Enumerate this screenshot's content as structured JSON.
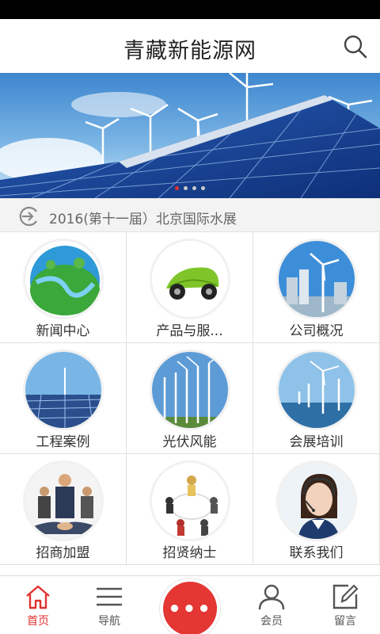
{
  "app": {
    "title": "青藏新能源网"
  },
  "colors": {
    "accent": "#e0312f",
    "header_bg": "#ffffff",
    "ticker_bg": "#f3f3f3"
  },
  "header": {
    "search_icon": "search-icon"
  },
  "banner": {
    "slides": 4,
    "active_slide": 1
  },
  "ticker": {
    "text": "2016(第十一届）北京国际水展",
    "icon": "refresh-arrow-icon"
  },
  "grid": {
    "items": [
      {
        "label": "新闻中心",
        "icon": "globe-green-icon"
      },
      {
        "label": "产品与服...",
        "icon": "leaf-car-icon"
      },
      {
        "label": "公司概况",
        "icon": "wind-turbine-city-icon"
      },
      {
        "label": "工程案例",
        "icon": "solar-field-icon"
      },
      {
        "label": "光伏风能",
        "icon": "wind-farm-icon"
      },
      {
        "label": "会展培训",
        "icon": "offshore-wind-icon"
      },
      {
        "label": "招商加盟",
        "icon": "handshake-icon"
      },
      {
        "label": "招贤纳士",
        "icon": "team-circle-icon"
      },
      {
        "label": "联系我们",
        "icon": "customer-service-icon"
      }
    ]
  },
  "tabbar": {
    "home": "首页",
    "nav": "导航",
    "more": "•••",
    "member": "会员",
    "message": "留言"
  }
}
